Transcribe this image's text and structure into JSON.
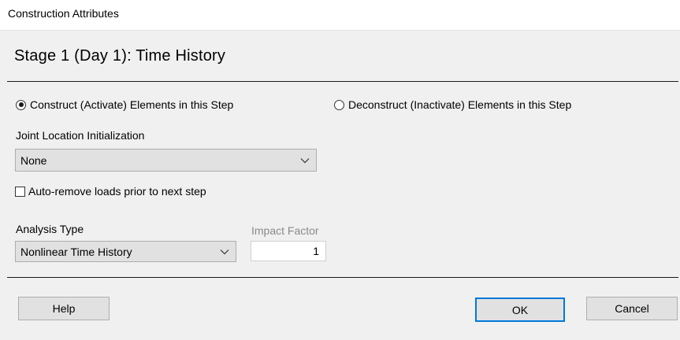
{
  "window": {
    "title": "Construction Attributes"
  },
  "heading": "Stage 1 (Day 1): Time History",
  "radios": {
    "construct_label": "Construct (Activate) Elements in this Step",
    "construct_checked": true,
    "deconstruct_label": "Deconstruct (Inactivate) Elements in this Step",
    "deconstruct_checked": false
  },
  "joint_location": {
    "label": "Joint Location Initialization",
    "value": "None"
  },
  "auto_remove": {
    "label": "Auto-remove loads prior to next step",
    "checked": false
  },
  "analysis_type": {
    "label": "Analysis Type",
    "value": "Nonlinear Time History"
  },
  "impact_factor": {
    "label": "Impact Factor",
    "value": "1"
  },
  "buttons": {
    "help": "Help",
    "ok": "OK",
    "cancel": "Cancel"
  },
  "icons": {
    "dropdown": "chevron-down-icon",
    "radio_selected": "radio-selected-icon",
    "radio_unselected": "radio-unselected-icon",
    "checkbox": "checkbox-unchecked-icon"
  },
  "colors": {
    "background": "#f0f0f0",
    "titlebar": "#ffffff",
    "button_face": "#e1e1e1",
    "default_button_border": "#0078d7",
    "disabled_label": "#8a8a8a"
  }
}
